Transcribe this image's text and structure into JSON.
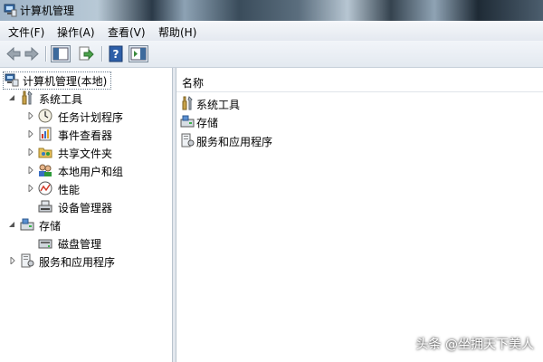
{
  "window": {
    "title": "计算机管理"
  },
  "menu": [
    "文件(F)",
    "操作(A)",
    "查看(V)",
    "帮助(H)"
  ],
  "toolbar": {
    "buttons": [
      "back-arrow-icon",
      "forward-arrow-icon",
      "show-hide-tree-icon",
      "export-list-icon",
      "help-icon",
      "action-pane-icon"
    ]
  },
  "tree": {
    "root": "计算机管理(本地)",
    "system_tools": {
      "label": "系统工具",
      "children": [
        "任务计划程序",
        "事件查看器",
        "共享文件夹",
        "本地用户和组",
        "性能",
        "设备管理器"
      ]
    },
    "storage": {
      "label": "存储",
      "children": [
        "磁盘管理"
      ]
    },
    "services": {
      "label": "服务和应用程序"
    }
  },
  "list": {
    "column_name": "名称",
    "items": [
      "系统工具",
      "存储",
      "服务和应用程序"
    ]
  },
  "watermark": "头条 @坐拥天下美人",
  "colors": {
    "accent_blue": "#2f6fb0",
    "pane_border": "#b9c3cd"
  }
}
